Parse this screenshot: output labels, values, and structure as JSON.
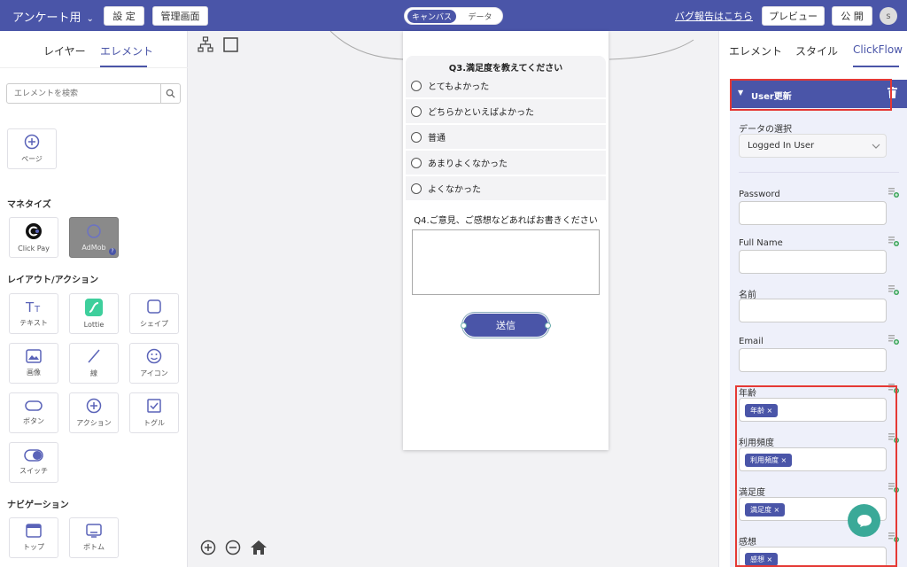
{
  "topbar": {
    "app_title": "アンケート用",
    "settings_label": "設 定",
    "admin_label": "管理画面",
    "toggle_canvas": "キャンバス",
    "toggle_data": "データ",
    "bug_report": "バグ報告はこちら",
    "preview_label": "プレビュー",
    "publish_label": "公 開",
    "avatar_initial": "s"
  },
  "left_panel": {
    "tab_layer": "レイヤー",
    "tab_element": "エレメント",
    "search_placeholder": "エレメントを検索",
    "page_tile": "ページ",
    "monetize_heading": "マネタイズ",
    "clickpay": "Click Pay",
    "admob": "AdMob",
    "layout_heading": "レイアウト/アクション",
    "text": "テキスト",
    "lottie": "Lottie",
    "shape": "シェイプ",
    "image": "画像",
    "line": "線",
    "icon": "アイコン",
    "button": "ボタン",
    "action": "アクション",
    "toggle": "トグル",
    "switch": "スイッチ",
    "nav_heading": "ナビゲーション",
    "top": "トップ",
    "bottom": "ボトム"
  },
  "canvas": {
    "q3_title": "Q3.満足度を教えてください",
    "options": [
      "とてもよかった",
      "どちらかといえばよかった",
      "普通",
      "あまりよくなかった",
      "よくなかった"
    ],
    "q4_title": "Q4.ご意見、ご感想などあればお書きください",
    "submit": "送信"
  },
  "right_panel": {
    "tab_element": "エレメント",
    "tab_style": "スタイル",
    "tab_clickflow": "ClickFlow",
    "action_title": "User更新",
    "data_select_label": "データの選択",
    "data_select_value": "Logged In User",
    "fields": {
      "password": "Password",
      "full_name": "Full Name",
      "name": "名前",
      "email": "Email",
      "age": "年齢",
      "frequency": "利用頻度",
      "satisfaction": "満足度",
      "impression": "感想"
    },
    "chips": {
      "age": "年齢 ×",
      "frequency": "利用頻度 ×",
      "satisfaction": "満足度 ×",
      "impression": "感想 ×"
    }
  },
  "colors": {
    "primary": "#4a55a8",
    "highlight": "#e53935",
    "chat": "#3aa998"
  }
}
